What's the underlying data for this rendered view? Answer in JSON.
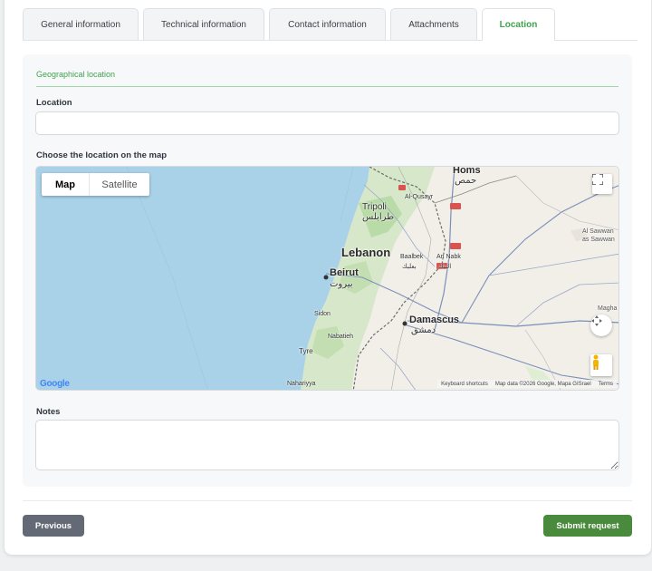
{
  "tabs": [
    {
      "label": "General information",
      "active": false
    },
    {
      "label": "Technical information",
      "active": false
    },
    {
      "label": "Contact information",
      "active": false
    },
    {
      "label": "Attachments",
      "active": false
    },
    {
      "label": "Location",
      "active": true
    }
  ],
  "section": {
    "title": "Geographical location"
  },
  "location_field": {
    "label": "Location",
    "value": "",
    "placeholder": ""
  },
  "map_field": {
    "label": "Choose the location on the map"
  },
  "map": {
    "type_buttons": {
      "map": "Map",
      "satellite": "Satellite",
      "selected": "Map"
    },
    "labels": {
      "homs": "Homs",
      "homs_ar": "حمص",
      "tripoli": "Tripoli",
      "tripoli_ar": "طرابلس",
      "lebanon": "Lebanon",
      "beirut": "Beirut",
      "beirut_ar": "بيروت",
      "damascus": "Damascus",
      "damascus_ar": "دمشق",
      "al_qusayr": "Al-Qusayr",
      "baalbek": "Baalbek",
      "baalbek_ar": "بعلبك",
      "an_nabk": "An Nabk",
      "an_nabk_ar": "النبك",
      "sidon": "Sidon",
      "nabatieh": "Nabatieh",
      "tyre": "Tyre",
      "nahariya": "Nahariyya",
      "as_sawwan": "Al Sawwan",
      "as_sawwan2": "as Sawwan",
      "maghar": "Magha"
    },
    "google_logo": "Google",
    "attribution": {
      "shortcuts": "Keyboard shortcuts",
      "data": "Map data ©2026 Google, Mapa GISrael",
      "terms": "Terms"
    },
    "icons": [
      "fullscreen-icon",
      "camera-control-icon",
      "pegman-icon"
    ]
  },
  "notes_field": {
    "label": "Notes",
    "value": "",
    "placeholder": ""
  },
  "buttons": {
    "previous": "Previous",
    "submit": "Submit request"
  },
  "colors": {
    "accent": "#3fa34d",
    "submit": "#4a8a3c",
    "previous": "#646a75",
    "sea": "#a9d2e8"
  }
}
